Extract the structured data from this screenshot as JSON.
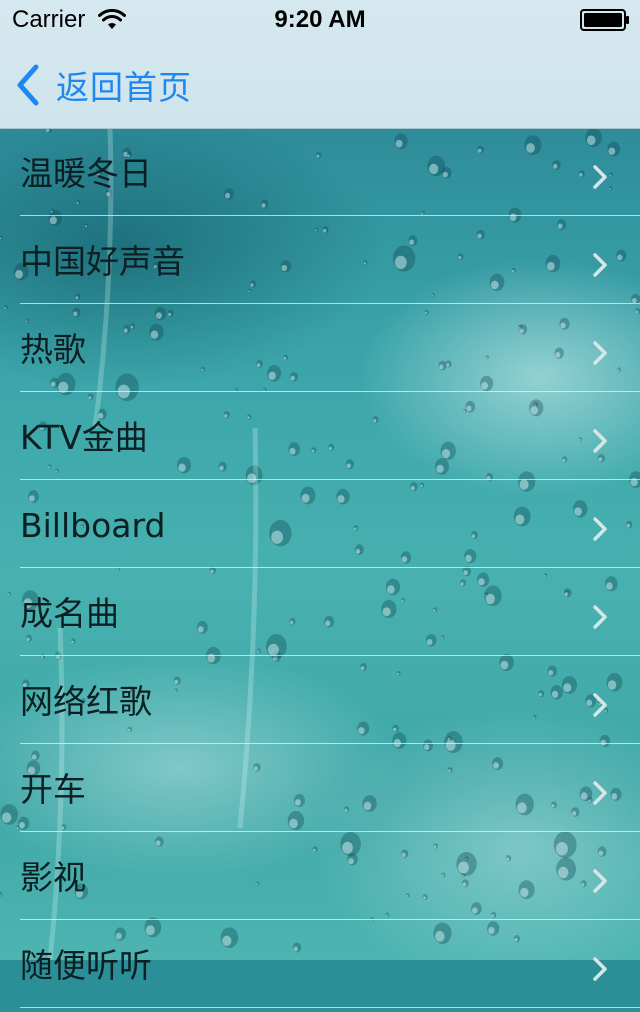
{
  "status_bar": {
    "carrier": "Carrier",
    "time": "9:20 AM",
    "wifi_icon": "wifi-icon",
    "battery_icon": "battery-icon"
  },
  "nav": {
    "back_label": "返回首页",
    "back_icon": "chevron-left-icon",
    "accent_color": "#1e88f0"
  },
  "list": {
    "items": [
      {
        "label": "温暖冬日"
      },
      {
        "label": "中国好声音"
      },
      {
        "label": "热歌"
      },
      {
        "label": "KTV金曲"
      },
      {
        "label": "Billboard"
      },
      {
        "label": "成名曲"
      },
      {
        "label": "网络红歌"
      },
      {
        "label": "开车"
      },
      {
        "label": "影视"
      },
      {
        "label": "随便听听"
      }
    ],
    "disclosure_icon": "chevron-right-icon"
  }
}
